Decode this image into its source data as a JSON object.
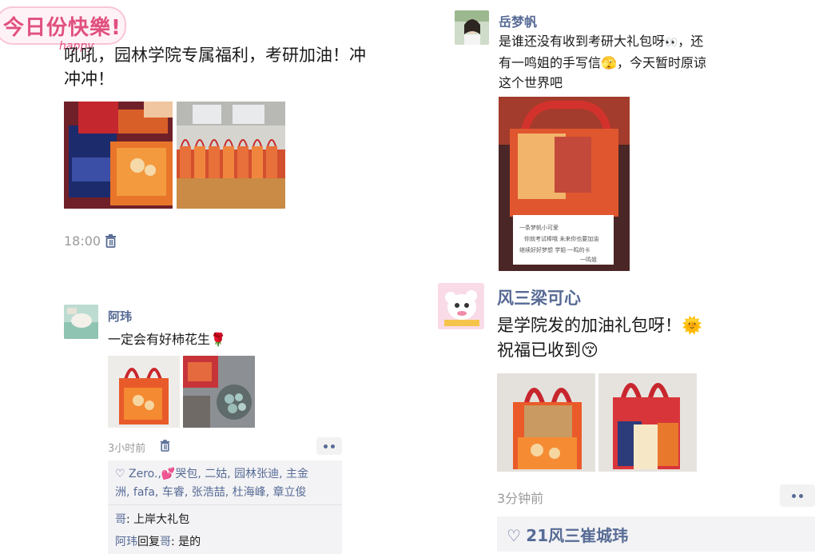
{
  "sticker": {
    "main": "今日份快樂!",
    "sub": "happy"
  },
  "post1": {
    "text_line1": "吼吼，园林学院专属福利，考研加油！冲",
    "text_line2": "冲冲！",
    "time": "18:00"
  },
  "post2": {
    "name": "阿玮",
    "text": "一定会有好柿花生",
    "emoji": "🌹",
    "time": "3小时前",
    "likes_line1": "Zero.,",
    "likes_emoji": "💕",
    "likes_line1b": "哭包, 二姑, 园林张迪, 主金",
    "likes_line2": "洲, fafa, 车睿, 张浩喆, 杜海峰, 章立俊",
    "likes_line3": "哥",
    "comment1": {
      "author": "哥",
      "text": ": 上岸大礼包"
    },
    "comment2": {
      "author": "阿玮",
      "reply_word": "回复",
      "target": "哥",
      "text": ": 是的"
    }
  },
  "post3": {
    "name": "岳梦帆",
    "text_line1": "是谁还没有收到考研大礼包呀",
    "emoji1": "👀",
    "text_line1b": "，还",
    "text_line2": "有一鸣姐的手写信",
    "emoji2": "🫣",
    "text_line2b": "，今天暂时原谅",
    "text_line3": "这个世界吧",
    "note_text": "一条梦帆小可爱 你就考试棒哦 未来你也要加油 继续好好梦想 学姐·一鸣的卡 一鸣姐"
  },
  "post4": {
    "name": "风三梁可心",
    "text_line1": "是学院发的加油礼包呀！",
    "emoji1": "🌞",
    "text_line2": "祝福已收到",
    "emoji2": "😚",
    "time": "3分钟前",
    "likes": "21风三崔城玮"
  },
  "colors": {
    "name": "#576b95",
    "gray": "#9b9b9b",
    "likes_bg": "#f3f3f5"
  }
}
